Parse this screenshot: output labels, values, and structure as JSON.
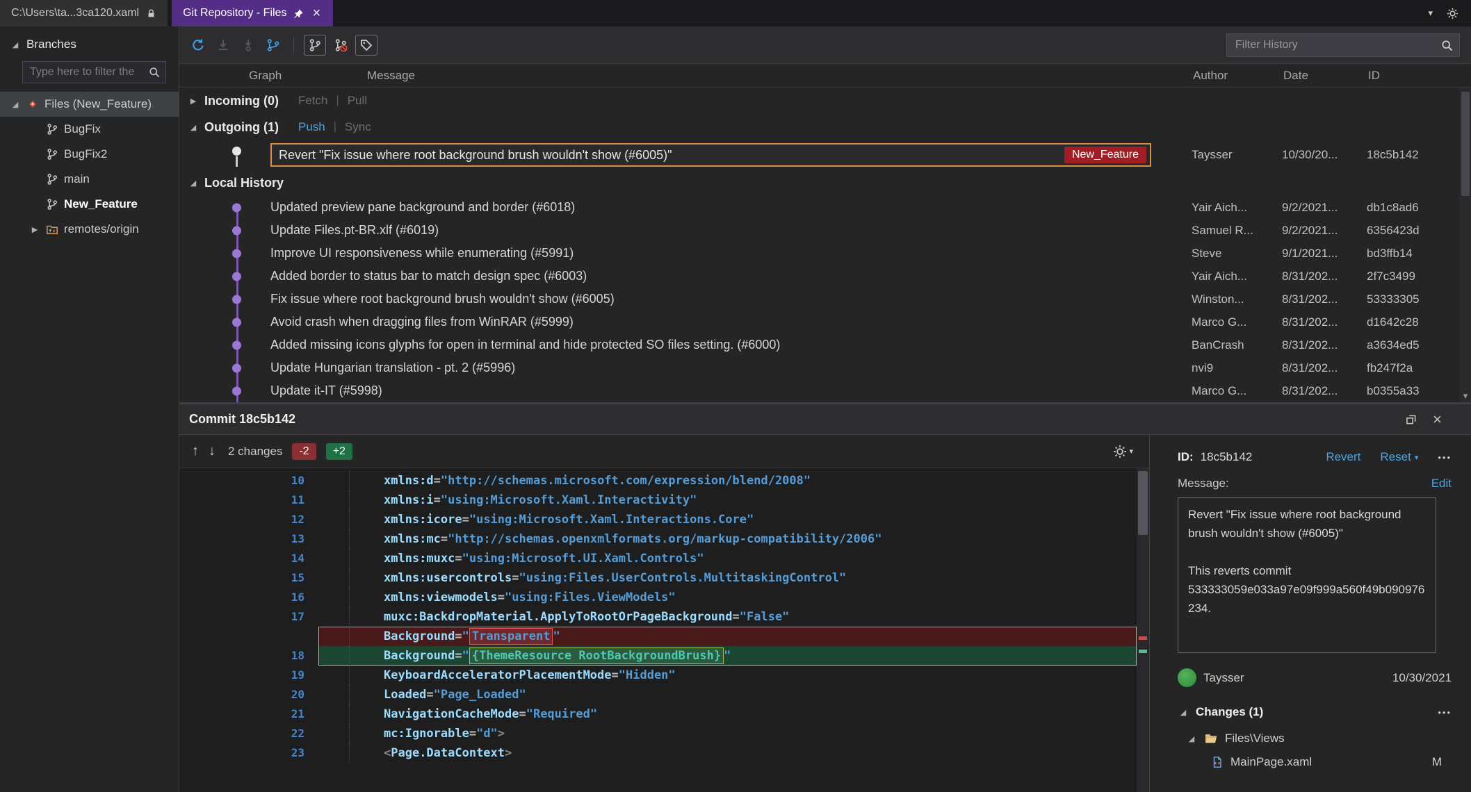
{
  "icons": {
    "expanded": "◢",
    "collapsed": "▶",
    "close": "×",
    "pipe": "|",
    "more": "•••",
    "dropdown": "▾",
    "up_arrow": "↑",
    "down_arrow": "↓"
  },
  "tabs": {
    "document_tab": "C:\\Users\\ta...3ca120.xaml",
    "git_tab": "Git Repository - Files"
  },
  "sidebar": {
    "title": "Branches",
    "filter_placeholder": "Type here to filter the",
    "tree": [
      {
        "label": "Files (New_Feature)",
        "icon": "repo",
        "expander": "expanded",
        "selected": true,
        "depth": 0
      },
      {
        "label": "BugFix",
        "icon": "branch",
        "expander": "",
        "depth": 1
      },
      {
        "label": "BugFix2",
        "icon": "branch",
        "expander": "",
        "depth": 1
      },
      {
        "label": "main",
        "icon": "branch",
        "expander": "",
        "depth": 1
      },
      {
        "label": "New_Feature",
        "icon": "branch",
        "expander": "",
        "depth": 1,
        "bold": true
      },
      {
        "label": "remotes/origin",
        "icon": "remote",
        "expander": "collapsed",
        "depth": 1
      }
    ]
  },
  "toolbar": {
    "filter_placeholder": "Filter History"
  },
  "history": {
    "columns": {
      "graph": "Graph",
      "message": "Message",
      "author": "Author",
      "date": "Date",
      "id": "ID"
    },
    "incoming": {
      "label": "Incoming (0)",
      "fetch": "Fetch",
      "pull": "Pull"
    },
    "outgoing": {
      "label": "Outgoing (1)",
      "push": "Push",
      "sync": "Sync"
    },
    "outgoing_commit": {
      "message": "Revert \"Fix issue where root background brush wouldn't show (#6005)\"",
      "badge": "New_Feature",
      "author": "Taysser",
      "date": "10/30/20...",
      "id": "18c5b142"
    },
    "local_history_label": "Local History",
    "commits": [
      {
        "message": "Updated preview pane background and border (#6018)",
        "author": "Yair Aich...",
        "date": "9/2/2021...",
        "id": "db1c8ad6"
      },
      {
        "message": "Update Files.pt-BR.xlf (#6019)",
        "author": "Samuel R...",
        "date": "9/2/2021...",
        "id": "6356423d"
      },
      {
        "message": "Improve UI responsiveness while enumerating (#5991)",
        "author": "Steve",
        "date": "9/1/2021...",
        "id": "bd3ffb14"
      },
      {
        "message": "Added border to status bar to match design spec (#6003)",
        "author": "Yair Aich...",
        "date": "8/31/202...",
        "id": "2f7c3499"
      },
      {
        "message": "Fix issue where root background brush wouldn't show (#6005)",
        "author": "Winston...",
        "date": "8/31/202...",
        "id": "53333305"
      },
      {
        "message": "Avoid crash when dragging files from WinRAR (#5999)",
        "author": "Marco G...",
        "date": "8/31/202...",
        "id": "d1642c28"
      },
      {
        "message": "Added missing icons glyphs for open in terminal and hide protected SO files setting. (#6000)",
        "author": "BanCrash",
        "date": "8/31/202...",
        "id": "a3634ed5"
      },
      {
        "message": "Update Hungarian translation - pt. 2 (#5996)",
        "author": "nvi9",
        "date": "8/31/202...",
        "id": "fb247f2a"
      },
      {
        "message": "Update it-IT (#5998)",
        "author": "Marco G...",
        "date": "8/31/202...",
        "id": "b0355a33"
      }
    ]
  },
  "commit_panel": {
    "title": "Commit 18c5b142",
    "changes_count": "2 changes",
    "deletions": "-2",
    "additions": "+2",
    "diff_lines": [
      {
        "num": "10",
        "type": "ctx",
        "segs": [
          [
            "xmlns:d",
            "attr"
          ],
          [
            "=",
            "op"
          ],
          [
            "\"http://schemas.microsoft.com/expression/blend/2008\"",
            "val"
          ]
        ]
      },
      {
        "num": "11",
        "type": "ctx",
        "segs": [
          [
            "xmlns:i",
            "attr"
          ],
          [
            "=",
            "op"
          ],
          [
            "\"using:Microsoft.Xaml.Interactivity\"",
            "val"
          ]
        ]
      },
      {
        "num": "12",
        "type": "ctx",
        "segs": [
          [
            "xmlns:icore",
            "attr"
          ],
          [
            "=",
            "op"
          ],
          [
            "\"using:Microsoft.Xaml.Interactions.Core\"",
            "val"
          ]
        ]
      },
      {
        "num": "13",
        "type": "ctx",
        "segs": [
          [
            "xmlns:mc",
            "attr"
          ],
          [
            "=",
            "op"
          ],
          [
            "\"http://schemas.openxmlformats.org/markup-compatibility/2006\"",
            "val"
          ]
        ]
      },
      {
        "num": "14",
        "type": "ctx",
        "segs": [
          [
            "xmlns:muxc",
            "attr"
          ],
          [
            "=",
            "op"
          ],
          [
            "\"using:Microsoft.UI.Xaml.Controls\"",
            "val"
          ]
        ]
      },
      {
        "num": "15",
        "type": "ctx",
        "segs": [
          [
            "xmlns:usercontrols",
            "attr"
          ],
          [
            "=",
            "op"
          ],
          [
            "\"using:Files.UserControls.MultitaskingControl\"",
            "val"
          ]
        ]
      },
      {
        "num": "16",
        "type": "ctx",
        "segs": [
          [
            "xmlns:viewmodels",
            "attr"
          ],
          [
            "=",
            "op"
          ],
          [
            "\"using:Files.ViewModels\"",
            "val"
          ]
        ]
      },
      {
        "num": "17",
        "type": "ctx",
        "segs": [
          [
            "muxc:BackdropMaterial.ApplyToRootOrPageBackground",
            "attr"
          ],
          [
            "=",
            "op"
          ],
          [
            "\"False\"",
            "val"
          ]
        ]
      },
      {
        "num": "",
        "type": "del",
        "segs": [
          [
            "Background",
            "attr"
          ],
          [
            "=",
            "op"
          ],
          [
            "\"",
            "val"
          ],
          [
            "Transparent",
            "val box-del"
          ],
          [
            "\"",
            "val"
          ]
        ]
      },
      {
        "num": "18",
        "type": "add",
        "segs": [
          [
            "Background",
            "attr"
          ],
          [
            "=",
            "op"
          ],
          [
            "\"",
            "val"
          ],
          [
            "{ThemeResource RootBackgroundBrush}",
            "ext box-add"
          ],
          [
            "\"",
            "val"
          ]
        ]
      },
      {
        "num": "19",
        "type": "ctx",
        "segs": [
          [
            "KeyboardAcceleratorPlacementMode",
            "attr"
          ],
          [
            "=",
            "op"
          ],
          [
            "\"Hidden\"",
            "val"
          ]
        ]
      },
      {
        "num": "20",
        "type": "ctx",
        "segs": [
          [
            "Loaded",
            "attr"
          ],
          [
            "=",
            "op"
          ],
          [
            "\"Page_Loaded\"",
            "val"
          ]
        ]
      },
      {
        "num": "21",
        "type": "ctx",
        "segs": [
          [
            "NavigationCacheMode",
            "attr"
          ],
          [
            "=",
            "op"
          ],
          [
            "\"Required\"",
            "val"
          ]
        ]
      },
      {
        "num": "22",
        "type": "ctx",
        "segs": [
          [
            "mc:Ignorable",
            "attr"
          ],
          [
            "=",
            "op"
          ],
          [
            "\"d\"",
            "val"
          ],
          [
            ">",
            "brk"
          ]
        ]
      },
      {
        "num": "23",
        "type": "ctx",
        "segs": [
          [
            "<",
            "brk"
          ],
          [
            "Page.DataContext",
            "tag"
          ],
          [
            ">",
            "brk"
          ]
        ]
      }
    ]
  },
  "details": {
    "id_label": "ID:",
    "id_value": "18c5b142",
    "revert_link": "Revert",
    "reset_link": "Reset",
    "message_label": "Message:",
    "edit_link": "Edit",
    "message": "Revert \"Fix issue where root background brush wouldn't show (#6005)\"\n\nThis reverts commit 533333059e033a97e09f999a560f49b090976234.",
    "author": "Taysser",
    "date": "10/30/2021",
    "changes_label": "Changes (1)",
    "folder_label": "Files\\Views",
    "file_label": "MainPage.xaml",
    "file_status": "M"
  }
}
